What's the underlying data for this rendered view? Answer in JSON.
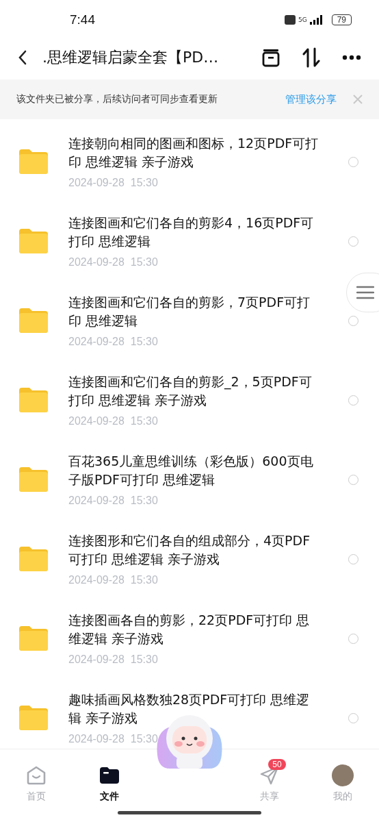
{
  "status_bar": {
    "time": "7:44",
    "network": "5G",
    "battery": "79"
  },
  "header": {
    "title": ".思维逻辑启蒙全套【PD…"
  },
  "share_banner": {
    "text": "该文件夹已被分享，后续访问者可同步查看更新",
    "action": "管理该分享"
  },
  "files": [
    {
      "name": "连接朝向相同的图画和图标，12页PDF可打印 思维逻辑 亲子游戏",
      "date": "2024-09-28",
      "time": "15:30",
      "selected": false
    },
    {
      "name": "连接图画和它们各自的剪影4，16页PDF可打印 思维逻辑",
      "date": "2024-09-28",
      "time": "15:30",
      "selected": false
    },
    {
      "name": "连接图画和它们各自的剪影，7页PDF可打印 思维逻辑",
      "date": "2024-09-28",
      "time": "15:30",
      "selected": false
    },
    {
      "name": "连接图画和它们各自的剪影_2，5页PDF可打印 思维逻辑 亲子游戏",
      "date": "2024-09-28",
      "time": "15:30",
      "selected": false
    },
    {
      "name": "百花365儿童思维训练（彩色版）600页电子版PDF可打印 思维逻辑",
      "date": "2024-09-28",
      "time": "15:30",
      "selected": false
    },
    {
      "name": "连接图形和它们各自的组成部分，4页PDF可打印 思维逻辑 亲子游戏",
      "date": "2024-09-28",
      "time": "15:30",
      "selected": false
    },
    {
      "name": "连接图画各自的剪影，22页PDF可打印 思维逻辑 亲子游戏",
      "date": "2024-09-28",
      "time": "15:30",
      "selected": false
    },
    {
      "name": "趣味插画风格数独28页PDF可打印 思维逻辑 亲子游戏",
      "date": "2024-09-28",
      "time": "15:30",
      "selected": false
    }
  ],
  "bottom_nav": [
    {
      "kind": "home",
      "label": "首页",
      "selected": false
    },
    {
      "kind": "files",
      "label": "文件",
      "selected": true
    },
    {
      "kind": "mascot"
    },
    {
      "kind": "share",
      "label": "共享",
      "selected": false,
      "badge": "50"
    },
    {
      "kind": "profile",
      "label": "我的",
      "selected": false
    }
  ]
}
